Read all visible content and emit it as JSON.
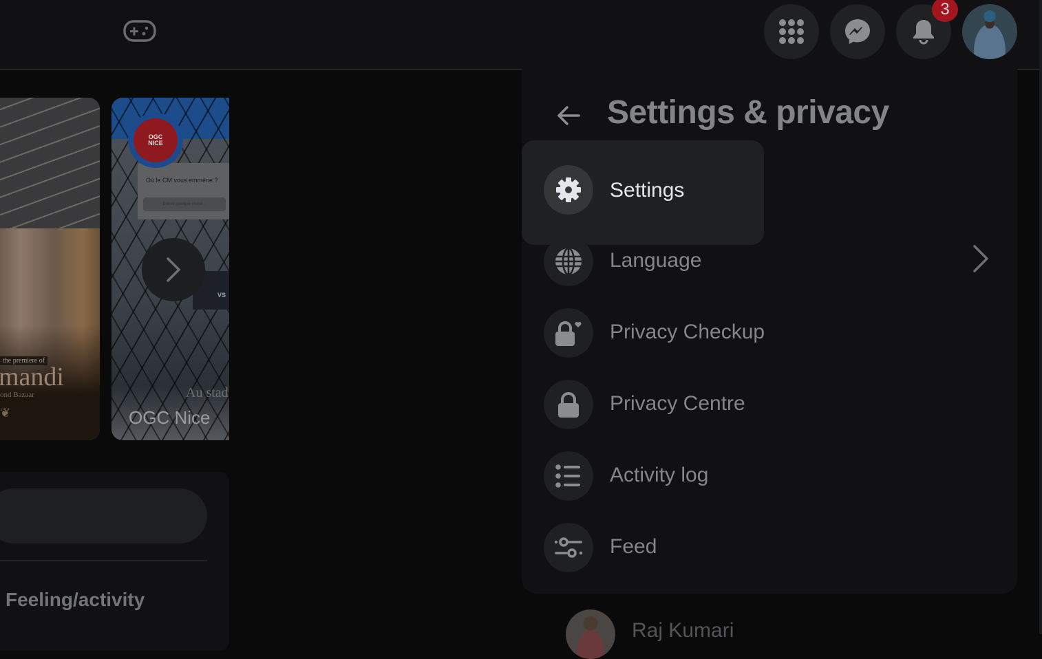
{
  "topbar": {
    "gaming_icon": "gaming-controller-icon",
    "menu_icon": "grid-menu-icon",
    "messenger_icon": "messenger-icon",
    "notifications_icon": "bell-icon",
    "notifications_count": "3"
  },
  "stories": [
    {
      "caption_small": "the premiere of",
      "caption_title": "mandi",
      "caption_sub": "ond Bazaar"
    },
    {
      "name": "OGC Nice",
      "logo_text": [
        "OGC",
        "NICE"
      ],
      "card_question": "Où le CM vous emmène ?",
      "card_placeholder": "Entrez quelque chose...",
      "overlay_text": "Au stad",
      "badge_text": "VS"
    }
  ],
  "composer": {
    "feeling_label": "Feeling/activity"
  },
  "settings_menu": {
    "title": "Settings & privacy",
    "back_icon": "arrow-left-icon",
    "items": [
      {
        "label": "Settings",
        "icon": "gear-icon",
        "highlighted": true
      },
      {
        "label": "Language",
        "icon": "globe-icon",
        "has_submenu": true
      },
      {
        "label": "Privacy Checkup",
        "icon": "lock-heart-icon"
      },
      {
        "label": "Privacy Centre",
        "icon": "lock-icon"
      },
      {
        "label": "Activity log",
        "icon": "list-icon"
      },
      {
        "label": "Feed",
        "icon": "sliders-icon"
      }
    ]
  },
  "contacts": [
    {
      "name": "Raj Kumari"
    }
  ],
  "colors": {
    "badge": "#a3151f",
    "menu_bg": "#111113",
    "highlight_bg": "#1f2022",
    "text_primary": "#e4e6eb",
    "text_dim": "#85868a"
  }
}
